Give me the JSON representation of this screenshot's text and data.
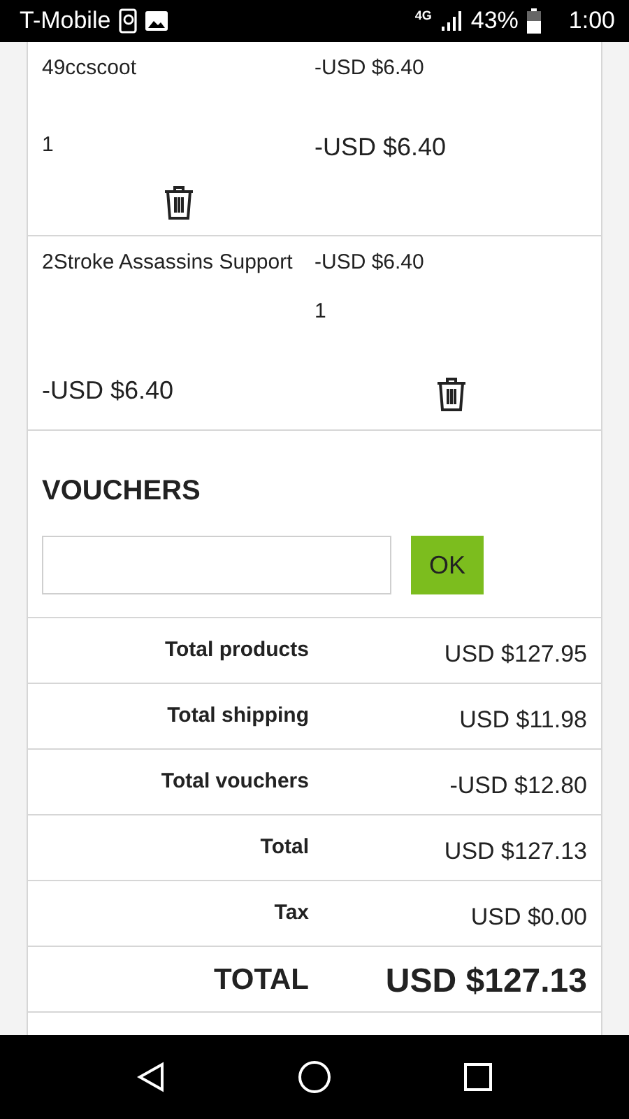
{
  "status_bar": {
    "carrier": "T-Mobile",
    "network": "4G",
    "battery": "43%",
    "time": "1:00"
  },
  "products": [
    {
      "kind": "stacked",
      "name": "49ccscoot",
      "price": "-USD $6.40",
      "quantity": "1",
      "total": "-USD $6.40"
    },
    {
      "kind": "wrapped",
      "name": "2Stroke Assassins Support",
      "price": "-USD $6.40",
      "quantity": "1",
      "total": "-USD $6.40"
    }
  ],
  "vouchers": {
    "title": "VOUCHERS",
    "button": "OK"
  },
  "totals": [
    {
      "kind": "line",
      "label": "Total products",
      "value": "USD $127.95"
    },
    {
      "kind": "line",
      "label": "Total shipping",
      "value": "USD $11.98"
    },
    {
      "kind": "line",
      "label": "Total vouchers",
      "value": "-USD $12.80"
    },
    {
      "kind": "line",
      "label": "Total",
      "value": "USD $127.13"
    },
    {
      "kind": "line",
      "label": "Tax",
      "value": "USD $0.00"
    },
    {
      "kind": "grand",
      "label": "TOTAL",
      "value": "USD $127.13"
    }
  ]
}
